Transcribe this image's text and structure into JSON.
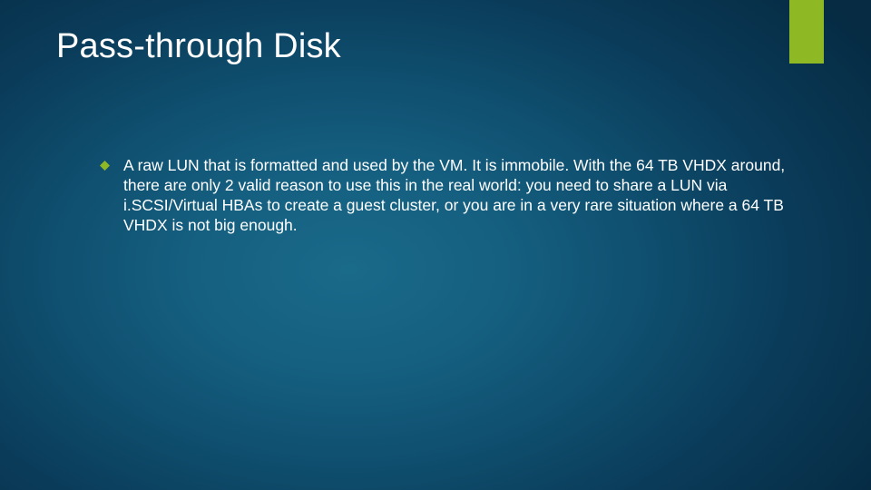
{
  "slide": {
    "title": "Pass-through Disk",
    "accent_color": "#8fb825",
    "bullets": [
      {
        "text": "A raw LUN that is formatted and used by the VM.  It is immobile.  With the 64 TB VHDX around, there are only 2 valid reason to use this in the real world: you need to share a LUN via i.SCSI/Virtual HBAs to create a guest cluster, or you are in a very rare situation where a 64 TB VHDX is not big enough."
      }
    ]
  }
}
